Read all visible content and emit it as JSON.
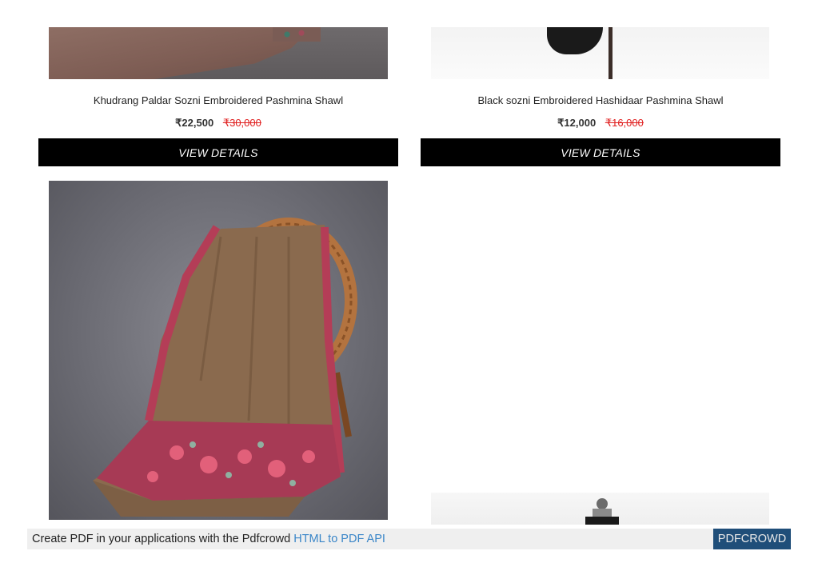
{
  "products": [
    {
      "title": "Khudrang Paldar Sozni Embroidered Pashmina Shawl",
      "price": "₹22,500",
      "old_price": "₹30,000",
      "button": "VIEW DETAILS"
    },
    {
      "title": "Black sozni Embroidered Hashidaar Pashmina Shawl",
      "price": "₹12,000",
      "old_price": "₹16,000",
      "button": "VIEW DETAILS"
    }
  ],
  "footer": {
    "text": "Create PDF in your applications with the Pdfcrowd",
    "link": "HTML to PDF API",
    "brand": "PDFCROWD"
  },
  "colors": {
    "button_bg": "#000000",
    "old_price": "#e02020",
    "link": "#3a86c8",
    "brand_bg": "#1f4e79"
  }
}
